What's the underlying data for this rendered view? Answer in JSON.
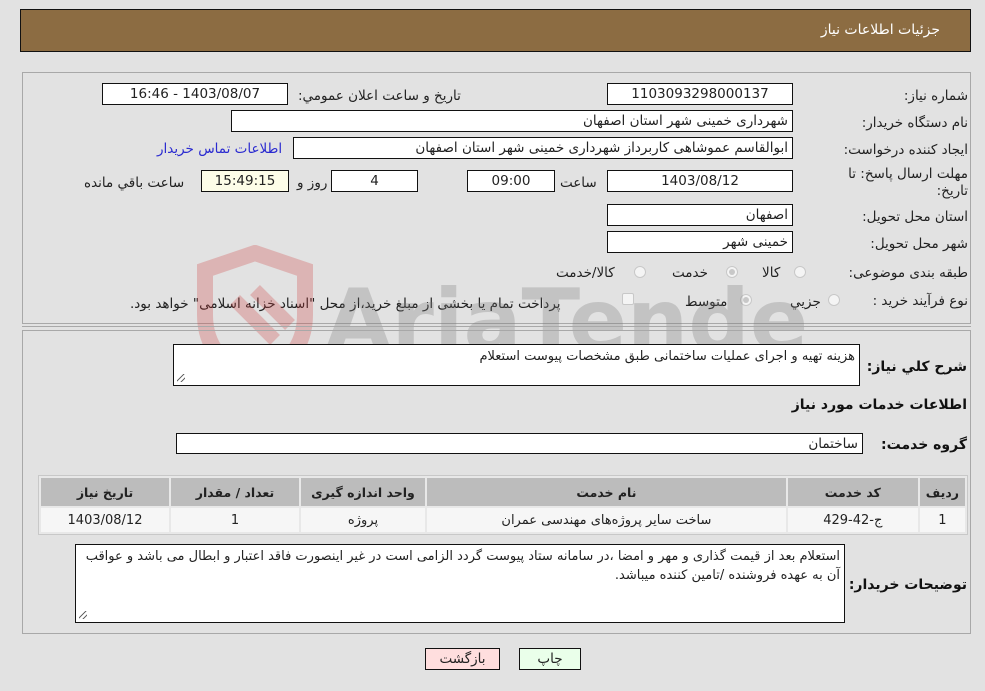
{
  "header": {
    "title": "جزئيات اطلاعات نياز"
  },
  "form": {
    "need_number_label": "شماره نياز:",
    "need_number": "1103093298000137",
    "announce_label": "تاريخ و ساعت اعلان عمومي:",
    "announce_value": "1403/08/07 - 16:46",
    "buyer_org_label": "نام دستگاه خريدار:",
    "buyer_org": "شهرداری خمینی شهر استان اصفهان",
    "creator_label": "ايجاد کننده درخواست:",
    "creator": "ابوالقاسم عموشاهی کاربرداز شهرداری خمینی شهر استان اصفهان",
    "contact_link": "اطلاعات تماس خريدار",
    "deadline_label": "مهلت ارسال پاسخ: تا تاريخ:",
    "deadline_date": "1403/08/12",
    "time_label": "ساعت",
    "deadline_time": "09:00",
    "days_value": "4",
    "days_label": "روز و",
    "remaining_time": "15:49:15",
    "remaining_label": "ساعت باقي مانده",
    "province_label": "استان محل تحويل:",
    "province": "اصفهان",
    "city_label": "شهر محل تحويل:",
    "city": "خمینی شهر",
    "category_label": "طبقه بندی موضوعی:",
    "category_options": [
      "کالا",
      "خدمت",
      "کالا/خدمت"
    ],
    "category_selected": "خدمت",
    "process_label": "نوع فرآيند خريد :",
    "process_options": [
      "جزيي",
      "متوسط"
    ],
    "process_selected": "متوسط",
    "treasury_note": "پرداخت تمام يا بخشی از مبلغ خريد،از محل \"اسناد خزانه اسلامی\" خواهد بود."
  },
  "details": {
    "description_label": "شرح کلي نياز:",
    "description": "هزینه تهیه و اجرای عملیات ساختمانی طبق مشخصات پیوست استعلام",
    "services_heading": "اطلاعات خدمات مورد نياز",
    "service_group_label": "گروه خدمت:",
    "service_group": "ساختمان",
    "table": {
      "headers": [
        "رديف",
        "کد خدمت",
        "نام خدمت",
        "واحد اندازه گيری",
        "تعداد / مقدار",
        "تاريخ نياز"
      ],
      "rows": [
        [
          "1",
          "ج-42-429",
          "ساخت سایر پروژه‌های مهندسی عمران",
          "پروژه",
          "1",
          "1403/08/12"
        ]
      ]
    },
    "buyer_notes_label": "توضيحات خريدار:",
    "buyer_notes": "استعلام بعد از قیمت گذاری و مهر و امضا ،در سامانه ستاد پیوست گردد الزامی است در غیر اینصورت فاقد اعتبار و ابطال می باشد و عواقب آن به عهده فروشنده /تامین کننده میباشد."
  },
  "buttons": {
    "print": "چاپ",
    "back": "بازگشت"
  },
  "watermark": {
    "text": "AriaTender.neT"
  },
  "colors": {
    "header": "#8c6c42",
    "print_button": "#eaffea",
    "back_button": "#ffdede",
    "remaining_box": "#fdfde8"
  }
}
